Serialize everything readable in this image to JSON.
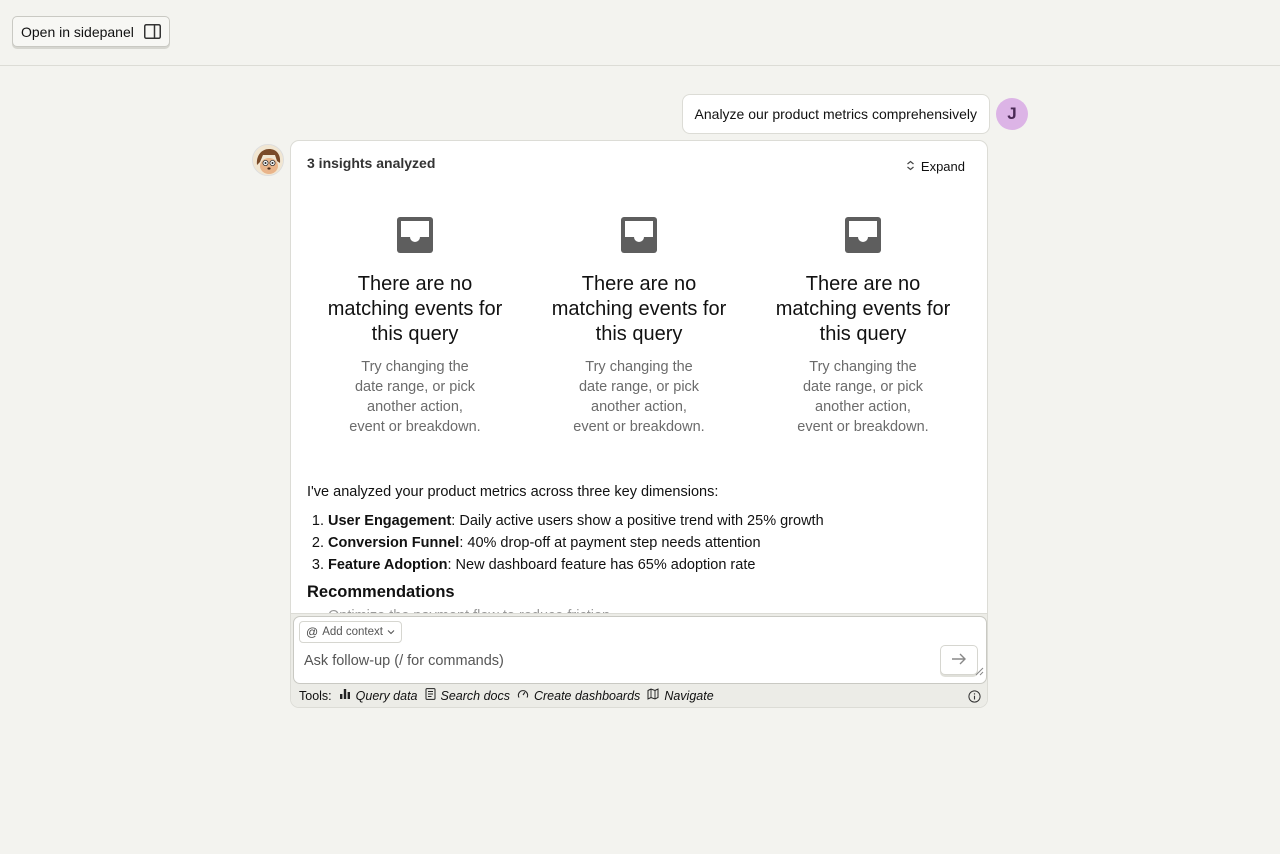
{
  "topbar": {
    "sidepanel_label": "Open in sidepanel"
  },
  "user_message": {
    "text": "Analyze our product metrics comprehensively",
    "avatar_initial": "J"
  },
  "card": {
    "title": "3 insights analyzed",
    "expand_label": "Expand",
    "insights": [
      {
        "empty_title": "There are no matching events for this query",
        "empty_desc": "Try changing the date range, or pick another action, event or breakdown."
      },
      {
        "empty_title": "There are no matching events for this query",
        "empty_desc": "Try changing the date range, or pick another action, event or breakdown."
      },
      {
        "empty_title": "There are no matching events for this query",
        "empty_desc": "Try changing the date range, or pick another action, event or breakdown."
      }
    ],
    "summary_intro": "I've analyzed your product metrics across three key dimensions:",
    "findings": [
      {
        "label": "User Engagement",
        "text": ": Daily active users show a positive trend with 25% growth"
      },
      {
        "label": "Conversion Funnel",
        "text": ": 40% drop-off at payment step needs attention"
      },
      {
        "label": "Feature Adoption",
        "text": ": New dashboard feature has 65% adoption rate"
      }
    ],
    "recommendations_heading": "Recommendations",
    "recommendations_partial": "Optimize the payment flow to reduce friction"
  },
  "composer": {
    "add_context_label": "Add context",
    "placeholder": "Ask follow-up (/ for commands)",
    "value": ""
  },
  "tools": {
    "label": "Tools:",
    "items": [
      "Query data",
      "Search docs",
      "Create dashboards",
      "Navigate"
    ]
  },
  "colors": {
    "background": "#f3f3ef",
    "avatar": "#dcb4e6",
    "muted_text": "#6b6b6b"
  }
}
